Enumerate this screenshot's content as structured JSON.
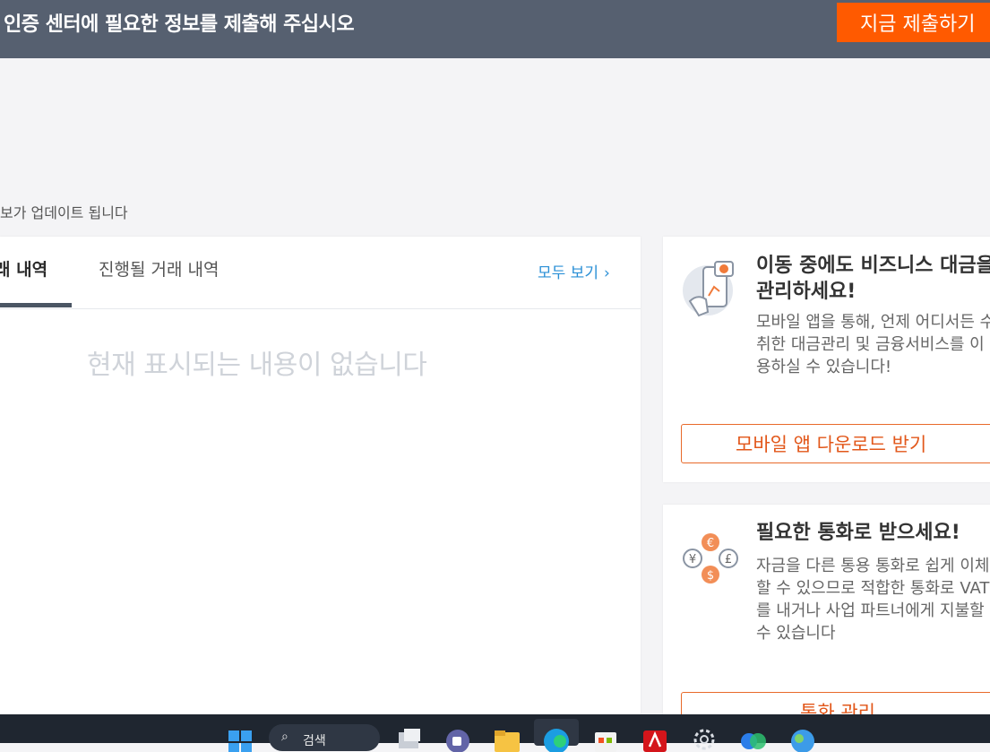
{
  "banner": {
    "message": "인증 센터에 필요한 정보를 제출해 주십시오",
    "submit_label": "지금 제출하기"
  },
  "update_note": "보가 업데이트 됩니다",
  "transactions": {
    "tabs": [
      {
        "label": "래 내역",
        "active": true
      },
      {
        "label": "진행될 거래 내역",
        "active": false
      }
    ],
    "view_all_label": "모두 보기",
    "empty_message": "현재 표시되는 내용이 없습니다"
  },
  "promos": {
    "mobile": {
      "title": "이동 중에도 비즈니스 대금을 관리하세요!",
      "description": "모바일 앱을 통해, 언제 어디서든 수취한 대금관리 및 금융서비스를 이용하실 수 있습니다!",
      "button_label": "모바일 앱 다운로드 받기"
    },
    "currency": {
      "title": "필요한 통화로 받으세요!",
      "description": "자금을 다른 통용 통화로 쉽게 이체할 수 있으므로 적합한 통화로 VAT를 내거나 사업 파트너에게 지불할 수 있습니다",
      "button_label": "통화 관리",
      "currency_symbols": [
        "€",
        "¥",
        "£",
        "$"
      ]
    }
  },
  "taskbar": {
    "search_label": "검색",
    "icons": [
      "windows-start-icon",
      "search-icon",
      "task-view-icon",
      "teams-icon",
      "file-explorer-icon",
      "edge-icon",
      "store-icon",
      "acrobat-icon",
      "settings-icon",
      "copilot-icon",
      "weather-icon"
    ]
  },
  "colors": {
    "banner_bg": "#566070",
    "accent_orange": "#ff5a00",
    "link_blue": "#2a8fd6",
    "taskbar_bg": "#1f2630"
  }
}
